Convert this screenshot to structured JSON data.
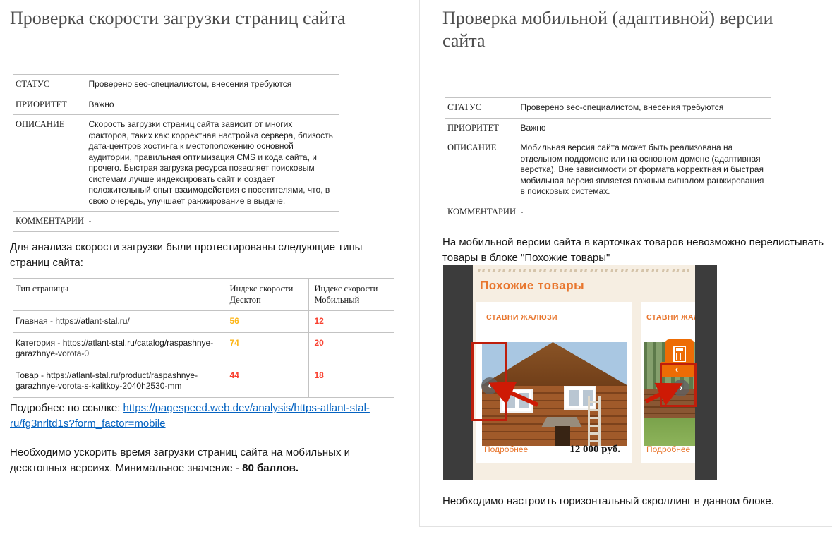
{
  "left_page": {
    "title": "Проверка скорости загрузки страниц сайта",
    "info_table": {
      "rows": [
        {
          "label": "СТАТУС",
          "value": "Проверено seo-специалистом, внесения требуются"
        },
        {
          "label": "ПРИОРИТЕТ",
          "value": "Важно"
        },
        {
          "label": "ОПИСАНИЕ",
          "value": "Скорость загрузки страниц сайта зависит от многих факторов, таких как: корректная настройка сервера, близость дата-центров хостинга к местоположению основной аудитории, правильная оптимизация CMS и кода сайта, и прочего. Быстрая загрузка ресурса позволяет поисковым системам лучше индексировать сайт и создает положительный опыт взаимодействия с посетителями, что, в свою очередь, улучшает ранжирование в выдаче."
        },
        {
          "label": "КОММЕНТАРИИ",
          "value": "-"
        }
      ]
    },
    "intro": "Для анализа скорости загрузки были протестированы следующие типы страниц сайта:",
    "speed_table": {
      "col_headers": [
        "Тип страницы",
        "Индекс скорости Десктоп",
        "Индекс скорости Мобильный"
      ],
      "rows": [
        {
          "page_type": "Главная - https://atlant-stal.ru/",
          "desktop": "56",
          "desktop_color": "#FDB515",
          "mobile": "12",
          "mobile_color": "#F9402F"
        },
        {
          "page_type": "Категория - https://atlant-stal.ru/catalog/raspashnye-garazhnye-vorota-0",
          "desktop": "74",
          "desktop_color": "#FDB515",
          "mobile": "20",
          "mobile_color": "#F9402F"
        },
        {
          "page_type": "Товар - https://atlant-stal.ru/product/raspashnye-garazhnye-vorota-s-kalitkoy-2040h2530-mm",
          "desktop": "44",
          "desktop_color": "#F9402F",
          "mobile": "18",
          "mobile_color": "#F9402F"
        }
      ]
    },
    "link_para": {
      "prefix": "Подробнее по ссылке: ",
      "url": "https://pagespeed.web.dev/analysis/https-atlant-stal-ru/fg3nrltd1s?form_factor=mobile"
    },
    "conclusion": {
      "normal": "Необходимо ускорить время загрузки страниц сайта на мобильных и десктопных версиях. Минимальное значение - ",
      "bold": "80 баллов."
    }
  },
  "right_page": {
    "title": "Проверка мобильной (адаптивной) версии сайта",
    "info_table": {
      "rows": [
        {
          "label": "СТАТУС",
          "value": "Проверено seo-специалистом, внесения требуются"
        },
        {
          "label": "ПРИОРИТЕТ",
          "value": "Важно"
        },
        {
          "label": "ОПИСАНИЕ",
          "value": "Мобильная версия сайта может быть реализована на отдельном поддомене или на основном домене (адаптивная верстка). Вне зависимости от формата корректная и быстрая мобильная версия является важным сигналом ранжирования в поисковых системах."
        },
        {
          "label": "КОММЕНТАРИИ",
          "value": "-"
        }
      ]
    },
    "issue_text": "На мобильной версии сайта в карточках товаров невозможно перелистывать товары в блоке \"Похожие товары\"",
    "screenshot": {
      "section_title": "Похожие товары",
      "card1": {
        "title": "СТАВНИ ЖАЛЮЗИ",
        "more": "Подробнее",
        "price": "12 000 руб."
      },
      "card2": {
        "title": "СТАВНИ ЖАЛ",
        "more": "Подробнее"
      },
      "icons": {
        "prev_glyph": "‹",
        "next_glyph": "›",
        "orange_prev_glyph": "‹",
        "calculator": "calculator-icon"
      }
    },
    "conclusion": "Необходимо настроить горизонтальный скроллинг в данном блоке."
  },
  "colors": {
    "title_gray": "#4e4e4e",
    "border_gray": "#c3c3c3",
    "link_blue": "#0563C1",
    "score_amber": "#FDB515",
    "score_red": "#F9402F",
    "shop_orange": "#E8762E",
    "shop_button_orange": "#ED6C05",
    "annotation_red": "#BE1E0C",
    "phone_dark": "#3C3C3C",
    "phone_cream": "#F6EEE2"
  }
}
